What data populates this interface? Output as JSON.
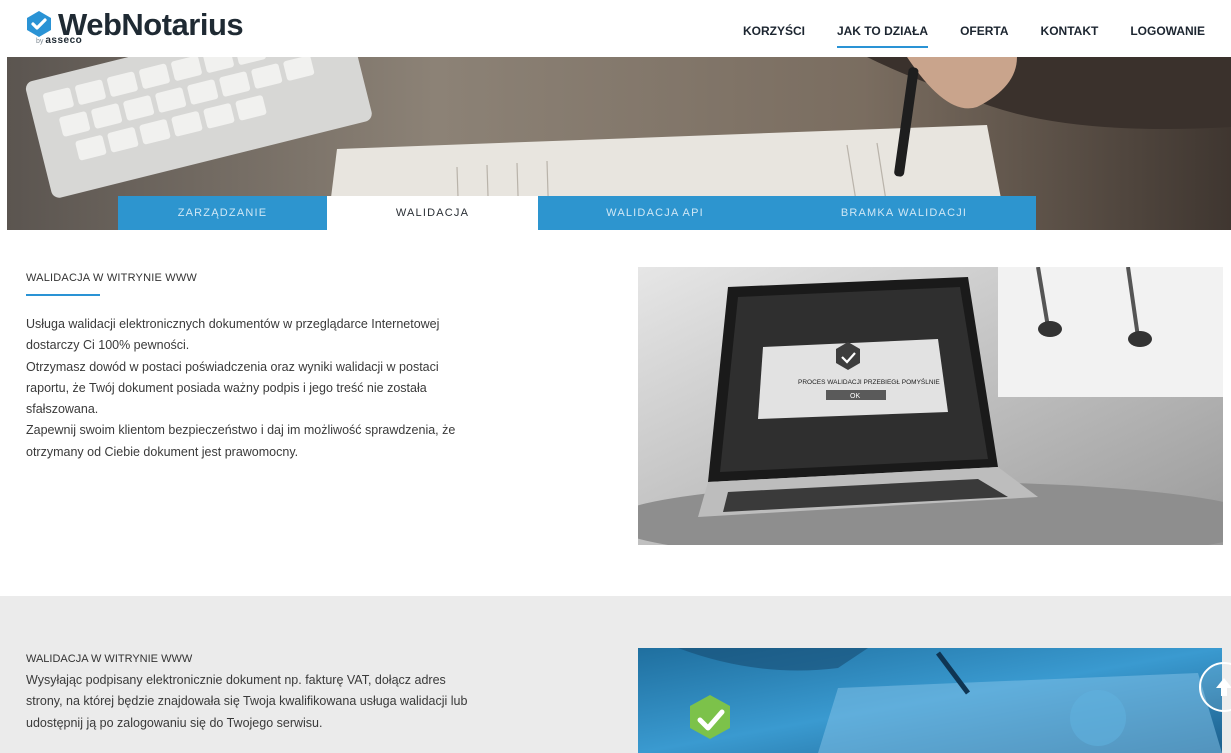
{
  "header": {
    "logo_text": "WebNotarius",
    "logo_by": "by",
    "logo_brand": "asseco",
    "nav": [
      {
        "label": "KORZYŚCI"
      },
      {
        "label": "JAK TO DZIAŁA",
        "active": true
      },
      {
        "label": "OFERTA"
      },
      {
        "label": "KONTAKT"
      },
      {
        "label": "LOGOWANIE"
      }
    ]
  },
  "hero": {
    "tabs": [
      {
        "label": "ZARZĄDZANIE"
      },
      {
        "label": "WALIDACJA",
        "active": true
      },
      {
        "label": "WALIDACJA API"
      },
      {
        "label": "BRAMKA WALIDACJI"
      }
    ]
  },
  "section1": {
    "title": "WALIDACJA W WITRYNIE WWW",
    "paragraphs": [
      "Usługa walidacji elektronicznych dokumentów w przeglądarce Internetowej dostarczy Ci 100% pewności.",
      "Otrzymasz dowód w postaci poświadczenia oraz wyniki walidacji w postaci raportu, że Twój dokument posiada ważny podpis i jego treść nie została sfałszowana.",
      "Zapewnij swoim klientom bezpieczeństwo i daj im możliwość sprawdzenia, że otrzymany od Ciebie dokument jest prawomocny."
    ],
    "image": {
      "dialog_text": "PROCES WALIDACJI PRZEBIEGŁ POMYŚLNIE",
      "ok_label": "OK"
    }
  },
  "section2": {
    "title": "WALIDACJA W WITRYNIE WWW",
    "paragraph": "Wysyłając podpisany elektronicznie dokument np. fakturę VAT, dołącz adres strony, na której będzie znajdowała się Twoja kwalifikowana usługa walidacji lub udostępnij ją po zalogowaniu się do Twojego serwisu."
  },
  "colors": {
    "accent": "#2a93d5",
    "tab_bar": "#2d95cf",
    "section2_bg": "#ebebeb",
    "check_green": "#7cc24a"
  },
  "icons": {
    "logo_mark": "check-icon",
    "scroll_top": "arrow-up-icon",
    "photo_check": "check-icon"
  }
}
